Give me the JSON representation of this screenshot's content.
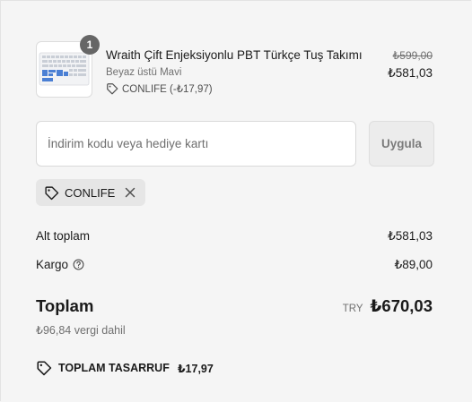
{
  "product": {
    "quantity": "1",
    "title": "Wraith Çift Enjeksiyonlu PBT Türkçe Tuş Takımı",
    "variant": "Beyaz üstü Mavi",
    "discount_tag": "CONLIFE (-₺17,97)",
    "original_price": "₺599,00",
    "price": "₺581,03",
    "icon": "tag-icon"
  },
  "discount_form": {
    "placeholder": "İndirim kodu veya hediye kartı",
    "value": "",
    "apply_label": "Uygula"
  },
  "applied_code": {
    "label": "CONLIFE",
    "icon": "tag-icon",
    "remove_icon": "close-icon"
  },
  "summary": {
    "subtotal_label": "Alt toplam",
    "subtotal_value": "₺581,03",
    "shipping_label": "Kargo",
    "shipping_value": "₺89,00",
    "total_label": "Toplam",
    "currency": "TRY",
    "total_value": "₺670,03",
    "tax_note": "₺96,84 vergi dahil",
    "savings_label": "TOPLAM TASARRUF",
    "savings_value": "₺17,97"
  },
  "colors": {
    "background": "#f5f5f5",
    "text": "#1a1a1a",
    "muted": "#707070",
    "badge": "#666666",
    "keycap_blue": "#4a7fd4"
  }
}
